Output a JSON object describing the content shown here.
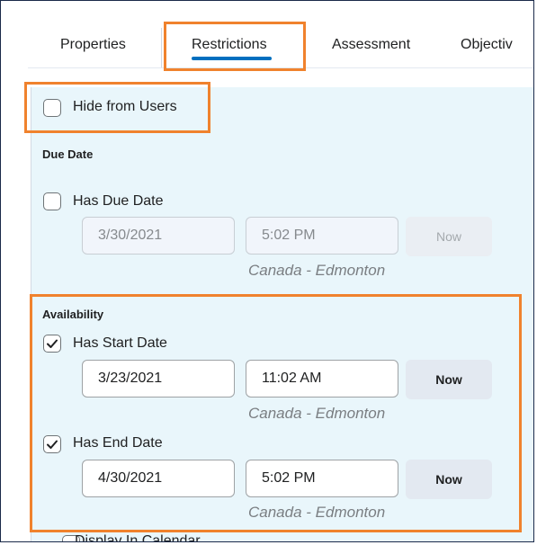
{
  "tabs": [
    {
      "label": "Properties"
    },
    {
      "label": "Restrictions"
    },
    {
      "label": "Assessment"
    },
    {
      "label": "Objectiv"
    }
  ],
  "hide_from_users": {
    "label": "Hide from Users",
    "checked": false
  },
  "due_date": {
    "heading": "Due Date",
    "checkbox_label": "Has Due Date",
    "checked": false,
    "date": "3/30/2021",
    "time": "5:02 PM",
    "now_label": "Now",
    "timezone": "Canada - Edmonton"
  },
  "availability": {
    "heading": "Availability",
    "start": {
      "checkbox_label": "Has Start Date",
      "checked": true,
      "date": "3/23/2021",
      "time": "11:02 AM",
      "now_label": "Now",
      "timezone": "Canada - Edmonton"
    },
    "end": {
      "checkbox_label": "Has End Date",
      "checked": true,
      "date": "4/30/2021",
      "time": "5:02 PM",
      "now_label": "Now",
      "timezone": "Canada - Edmonton"
    },
    "display_in_calendar_label": "Display In Calendar"
  },
  "colors": {
    "panel_bg": "#e9f6fb",
    "accent_blue": "#006fbf",
    "highlight_orange": "#f0822d"
  }
}
